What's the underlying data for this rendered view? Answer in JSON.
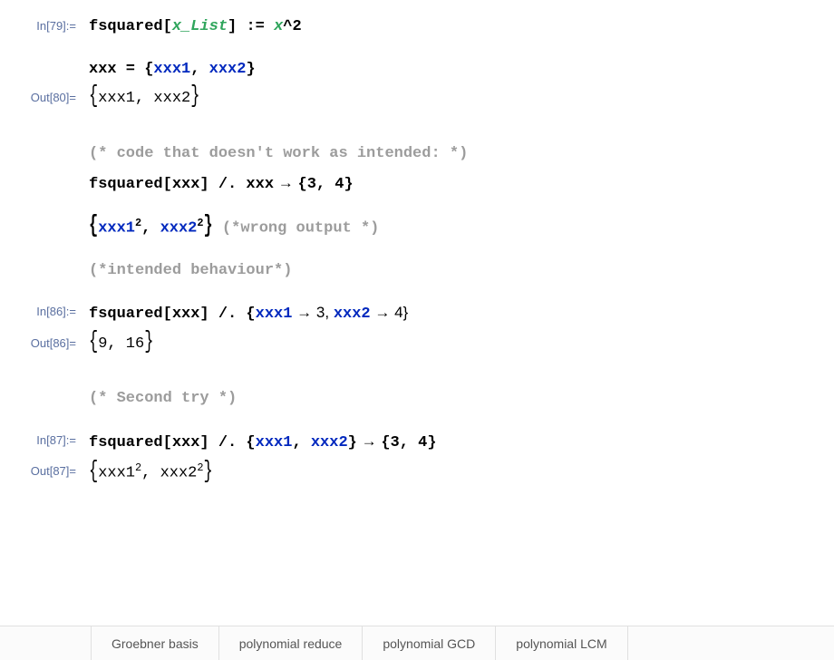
{
  "labels": {
    "in79": "In[79]:=",
    "out80": "Out[80]=",
    "in86": "In[86]:=",
    "out86": "Out[86]=",
    "in87": "In[87]:=",
    "out87": "Out[87]="
  },
  "code": {
    "in79_p1": "fsquared[",
    "in79_p2": "x_List",
    "in79_p3": "] := ",
    "in79_p4": "x",
    "in79_p5": "^2",
    "assign_p1": "xxx = {",
    "assign_p2": "xxx1",
    "assign_p3": ", ",
    "assign_p4": "xxx2",
    "assign_p5": "}",
    "out80_open": "{",
    "out80_body": "xxx1, xxx2",
    "out80_close": "}",
    "comment1": "(*  code that doesn't work as intended: *)",
    "wrong_p1": "fsquared[xxx] /. xxx",
    "wrong_arrow": " → ",
    "wrong_p2": "{3, 4}",
    "wrongout_open": "{",
    "wrongout_s1": "xxx1",
    "wrongout_sup": "2",
    "wrongout_sep": ", ",
    "wrongout_s2": "xxx2",
    "wrongout_close": "}",
    "comment_wrong": " (*wrong output *)",
    "comment_intended": "(*intended behaviour*)",
    "in86_p1": "fsquared[xxx] /. {",
    "in86_p2": "xxx1",
    "in86_p3": " → 3, ",
    "in86_p4": "xxx2",
    "in86_p5": " → 4}",
    "out86_open": "{",
    "out86_body": "9, 16",
    "out86_close": "}",
    "comment_second": "(*  Second try *)",
    "in87_p1": "fsquared[xxx] /. {",
    "in87_p2": "xxx1",
    "in87_p3": ", ",
    "in87_p4": "xxx2",
    "in87_p5": "}",
    "in87_arrow": " → ",
    "in87_p6": "{3, 4}",
    "out87_open": "{",
    "out87_s1": "xxx1",
    "out87_sup": "2",
    "out87_sep": ", ",
    "out87_s2": "xxx2",
    "out87_close": "}"
  },
  "bottombar": {
    "item1": "Groebner basis",
    "item2": "polynomial reduce",
    "item3": "polynomial GCD",
    "item4": "polynomial LCM"
  }
}
